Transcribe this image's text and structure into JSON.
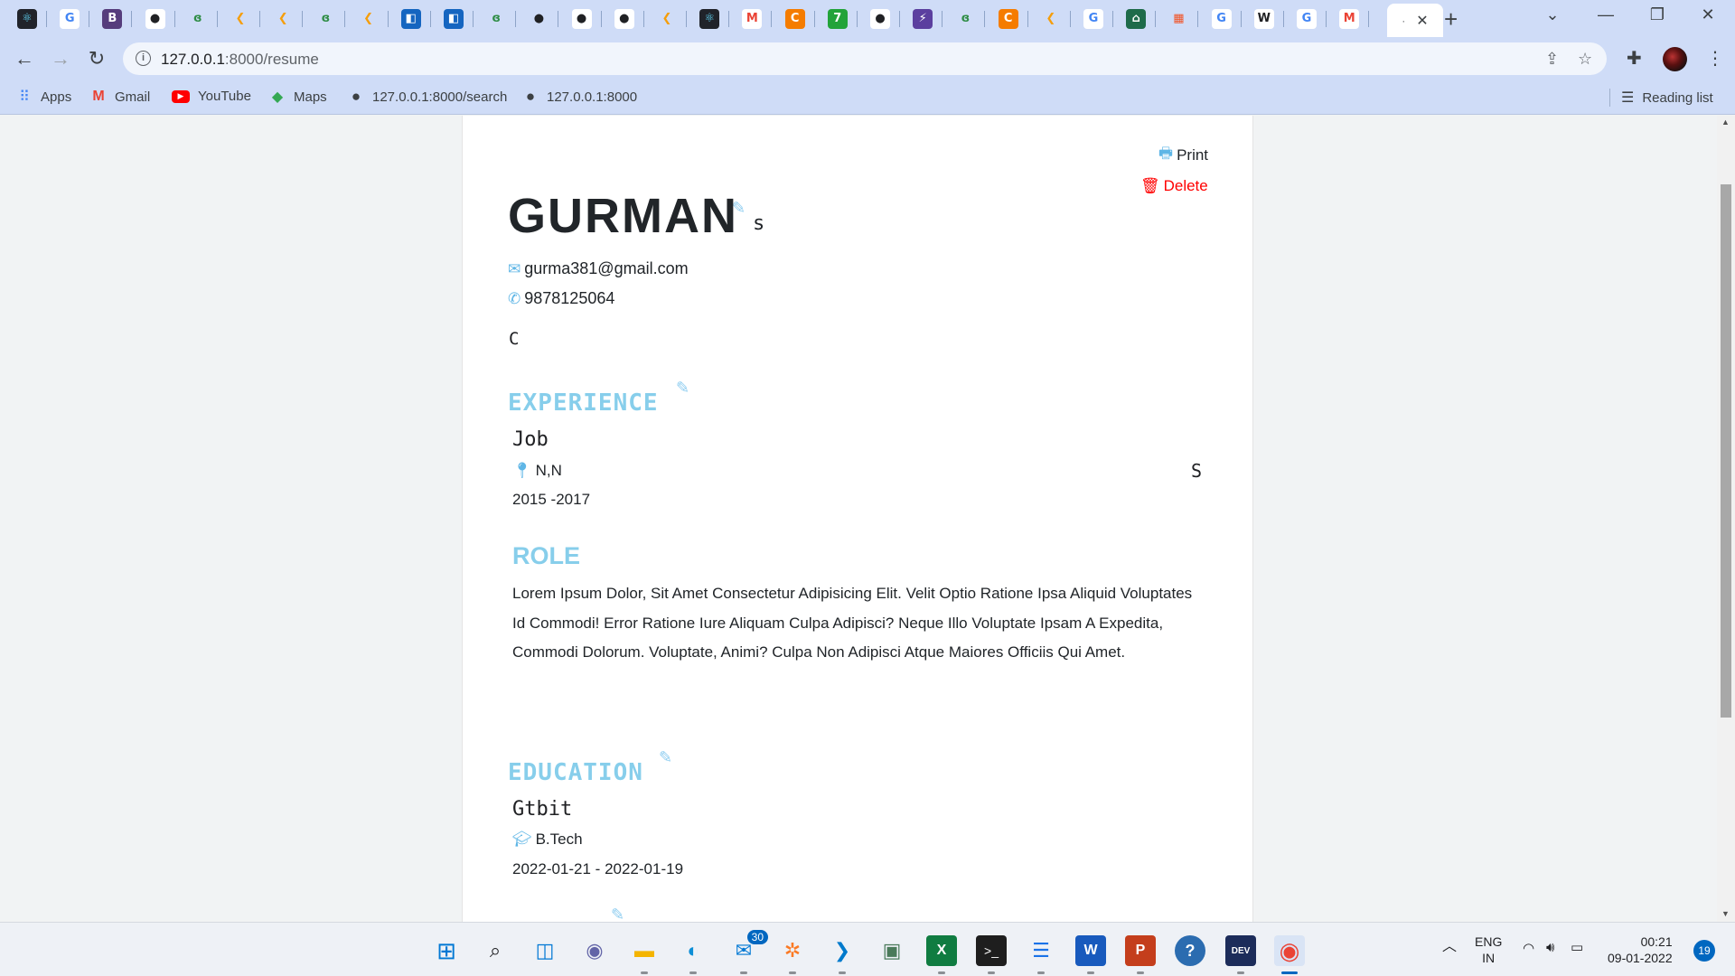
{
  "browser": {
    "tabs": [
      {
        "icon": "react-icon",
        "glyph": "⚛",
        "bg": "#20232a",
        "fg": "#61dafb"
      },
      {
        "icon": "google-icon",
        "glyph": "G",
        "bg": "#ffffff",
        "fg": "#4285f4"
      },
      {
        "icon": "bootstrap-icon",
        "glyph": "B",
        "bg": "#563d7c",
        "fg": "#ffffff"
      },
      {
        "icon": "globe-icon",
        "glyph": "●",
        "bg": "#ffffff",
        "fg": "#202124"
      },
      {
        "icon": "geeksforgeeks-icon",
        "glyph": "ɞ",
        "bg": "#cfdcf7",
        "fg": "#2f8d46"
      },
      {
        "icon": "codeium-icon",
        "glyph": "❮",
        "bg": "#cfdcf7",
        "fg": "#f59e0b"
      },
      {
        "icon": "codeium-icon",
        "glyph": "❮",
        "bg": "#cfdcf7",
        "fg": "#f59e0b"
      },
      {
        "icon": "geeksforgeeks-icon",
        "glyph": "ɞ",
        "bg": "#cfdcf7",
        "fg": "#2f8d46"
      },
      {
        "icon": "codeium-icon",
        "glyph": "❮",
        "bg": "#cfdcf7",
        "fg": "#f59e0b"
      },
      {
        "icon": "cube-icon",
        "glyph": "◧",
        "bg": "#1565c0",
        "fg": "#ffffff"
      },
      {
        "icon": "cube-icon",
        "glyph": "◧",
        "bg": "#1565c0",
        "fg": "#ffffff"
      },
      {
        "icon": "geeksforgeeks-icon",
        "glyph": "ɞ",
        "bg": "#cfdcf7",
        "fg": "#2f8d46"
      },
      {
        "icon": "github-icon",
        "glyph": "●",
        "bg": "#cfdcf7",
        "fg": "#202124"
      },
      {
        "icon": "globe-icon",
        "glyph": "●",
        "bg": "#ffffff",
        "fg": "#202124"
      },
      {
        "icon": "globe-icon",
        "glyph": "●",
        "bg": "#ffffff",
        "fg": "#202124"
      },
      {
        "icon": "codeium-icon",
        "glyph": "❮",
        "bg": "#cfdcf7",
        "fg": "#f59e0b"
      },
      {
        "icon": "react-icon",
        "glyph": "⚛",
        "bg": "#20232a",
        "fg": "#61dafb"
      },
      {
        "icon": "gmail-icon",
        "glyph": "M",
        "bg": "#ffffff",
        "fg": "#ea4335"
      },
      {
        "icon": "codechef-icon",
        "glyph": "C",
        "bg": "#f57c00",
        "fg": "#ffffff"
      },
      {
        "icon": "green-circle-icon",
        "glyph": "7",
        "bg": "#22a33a",
        "fg": "#ffffff"
      },
      {
        "icon": "globe-icon",
        "glyph": "●",
        "bg": "#ffffff",
        "fg": "#202124"
      },
      {
        "icon": "bolt-icon",
        "glyph": "⚡",
        "bg": "#5b3f9f",
        "fg": "#ffffff"
      },
      {
        "icon": "geeksforgeeks-icon",
        "glyph": "ɞ",
        "bg": "#cfdcf7",
        "fg": "#2f8d46"
      },
      {
        "icon": "codechef-icon",
        "glyph": "C",
        "bg": "#f57c00",
        "fg": "#ffffff"
      },
      {
        "icon": "codeium-icon",
        "glyph": "❮",
        "bg": "#cfdcf7",
        "fg": "#f59e0b"
      },
      {
        "icon": "google-icon",
        "glyph": "G",
        "bg": "#ffffff",
        "fg": "#4285f4"
      },
      {
        "icon": "home-icon",
        "glyph": "⌂",
        "bg": "#1e6b4a",
        "fg": "#ffffff"
      },
      {
        "icon": "microsoft-icon",
        "glyph": "▦",
        "bg": "#cfdcf7",
        "fg": "#f25022"
      },
      {
        "icon": "google-icon",
        "glyph": "G",
        "bg": "#ffffff",
        "fg": "#4285f4"
      },
      {
        "icon": "wikipedia-icon",
        "glyph": "W",
        "bg": "#ffffff",
        "fg": "#202124"
      },
      {
        "icon": "google-icon",
        "glyph": "G",
        "bg": "#ffffff",
        "fg": "#4285f4"
      },
      {
        "icon": "gmail-icon",
        "glyph": "M",
        "bg": "#ffffff",
        "fg": "#ea4335"
      }
    ],
    "active_tab_title": "·"
  },
  "toolbar": {
    "url_host": "127.0.0.1",
    "url_path": ":8000/resume"
  },
  "bookmarks": {
    "apps": "Apps",
    "gmail": "Gmail",
    "youtube": "YouTube",
    "maps": "Maps",
    "search_link": "127.0.0.1:8000/search",
    "home_link": "127.0.0.1:8000",
    "reading_list": "Reading list"
  },
  "resume": {
    "print_label": "Print",
    "delete_label": "Delete",
    "first_name": "GURMAN",
    "last_name": "s",
    "email": "gurma381@gmail.com",
    "phone": "9878125064",
    "summary": "C",
    "experience": {
      "heading": "EXPERIENCE",
      "job_title": "Job",
      "location": "N,N",
      "duration": "2015 -2017",
      "right_label": "S",
      "role_heading": "ROLE",
      "role_text": "Lorem Ipsum Dolor, Sit Amet Consectetur Adipisicing Elit. Velit Optio Ratione Ipsa Aliquid Voluptates Id Commodi! Error Ratione Iure Aliquam Culpa Adipisci? Neque Illo Voluptate Ipsam A Expedita, Commodi Dolorum. Voluptate, Animi? Culpa Non Adipisci Atque Maiores Officiis Qui Amet."
    },
    "education": {
      "heading": "EDUCATION",
      "institute": "Gtbit",
      "degree": "B.Tech",
      "dates": "2022-01-21 - 2022-01-19"
    }
  },
  "taskbar": {
    "mail_badge": "30",
    "lang_top": "ENG",
    "lang_bottom": "IN",
    "time": "00:21",
    "date": "09-01-2022",
    "notification_count": "19"
  }
}
